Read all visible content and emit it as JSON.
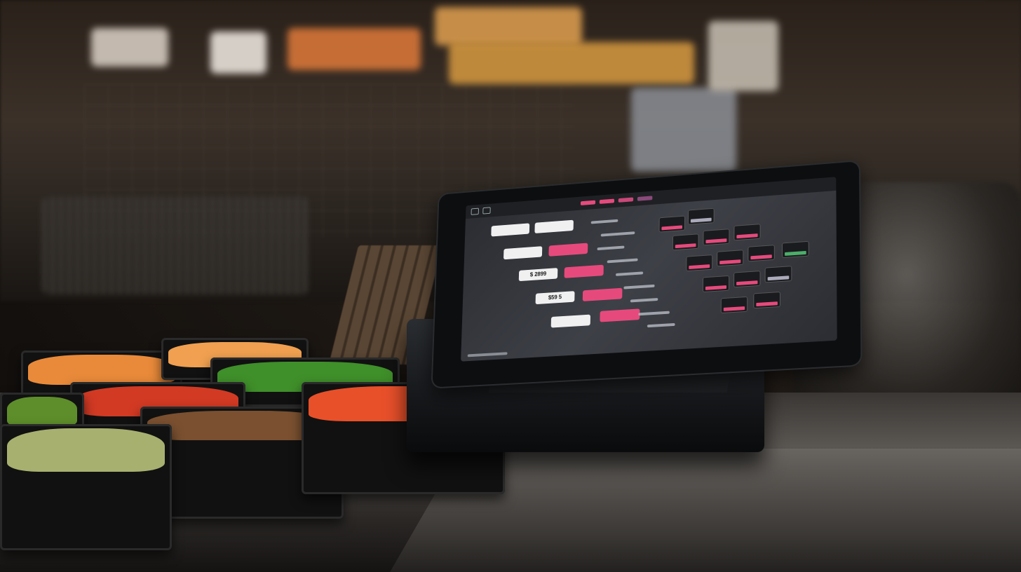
{
  "scene": {
    "colors": {
      "accent_pink": "#e64a7c",
      "screen_bg": "#33353b",
      "button_white": "#f0f0f0",
      "counter": "#4a4643"
    }
  },
  "pos_screen": {
    "left_buttons": [
      {
        "label": "",
        "style": "white"
      },
      {
        "label": "",
        "style": "white"
      },
      {
        "label": "",
        "style": "white"
      },
      {
        "label": "",
        "style": "pink"
      },
      {
        "label": "$ 2899",
        "style": "white"
      },
      {
        "label": "",
        "style": "pink"
      },
      {
        "label": "$59 5",
        "style": "white"
      },
      {
        "label": "",
        "style": "pink"
      },
      {
        "label": "",
        "style": "white"
      },
      {
        "label": "",
        "style": "pink"
      }
    ],
    "tile_count": 14
  },
  "trays": [
    {
      "food": "shredded-carrots",
      "color": "#e98a3a"
    },
    {
      "food": "shredded-carrots",
      "color": "#f0a050"
    },
    {
      "food": "chopped-herbs",
      "color": "#3f8f2a"
    },
    {
      "food": "red-peppers",
      "color": "#d23a24"
    },
    {
      "food": "green-vegetables",
      "color": "#5e8e2b"
    },
    {
      "food": "meat",
      "color": "#7a5030"
    },
    {
      "food": "mixed-vegetables",
      "color": "#e8502a"
    },
    {
      "food": "cabbage",
      "color": "#a8b070"
    }
  ]
}
